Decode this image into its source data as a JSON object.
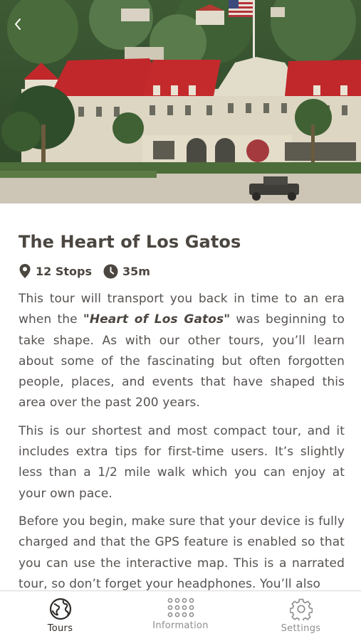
{
  "header": {
    "back_icon": "chevron-left-icon"
  },
  "tour": {
    "title": "The Heart of Los Gatos",
    "stops": "12 Stops",
    "duration": "35m",
    "paragraphs": {
      "p1_before": "This tour will transport you back in time to an era when the ",
      "p1_emphasis": "\"Heart of Los Gatos\"",
      "p1_after": " was beginning to take shape. As with our other tours, you’ll learn about some of the fascinating but often forgotten people, places, and events that have shaped this area over the past 200 years.",
      "p2": "This is our shortest and most compact tour, and it includes extra tips for first-time users. It’s slightly less than a 1/2 mile walk which you can enjoy at your own pace.",
      "p3": "Before you begin, make sure that your device is fully charged and that the GPS feature is enabled so that you can use the interactive map. This is a narrated tour, so don’t forget your headphones. You’ll also"
    }
  },
  "tabbar": {
    "tabs": [
      {
        "label": "Tours",
        "icon": "globe-icon",
        "active": true
      },
      {
        "label": "Information",
        "icon": "grid-icon",
        "active": false
      },
      {
        "label": "Settings",
        "icon": "gear-icon",
        "active": false
      }
    ]
  },
  "colors": {
    "roof_red": "#c0282b",
    "text_dark": "#4b4640",
    "text_body": "#565250",
    "tab_inactive": "#8e8e8e"
  }
}
